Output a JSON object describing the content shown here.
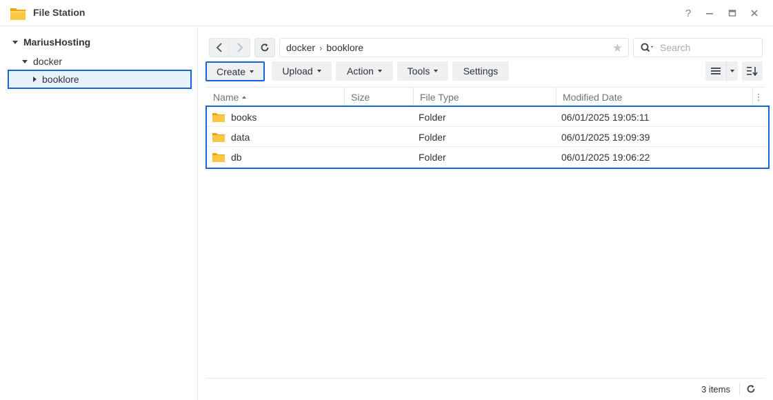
{
  "window": {
    "title": "File Station",
    "help_icon": "help-icon",
    "minimize_icon": "minimize-icon",
    "maximize_icon": "maximize-icon",
    "close_icon": "close-icon"
  },
  "tree": {
    "root": "MariusHosting",
    "children": [
      {
        "label": "docker",
        "expanded": true
      },
      {
        "label": "booklore",
        "selected": true
      }
    ]
  },
  "nav": {
    "path": [
      "docker",
      "booklore"
    ],
    "search_placeholder": "Search"
  },
  "toolbar": {
    "create": "Create",
    "upload": "Upload",
    "action": "Action",
    "tools": "Tools",
    "settings": "Settings"
  },
  "table": {
    "columns": [
      "Name",
      "Size",
      "File Type",
      "Modified Date"
    ],
    "rows": [
      {
        "name": "books",
        "size": "",
        "type": "Folder",
        "modified": "06/01/2025 19:05:11"
      },
      {
        "name": "data",
        "size": "",
        "type": "Folder",
        "modified": "06/01/2025 19:09:39"
      },
      {
        "name": "db",
        "size": "",
        "type": "Folder",
        "modified": "06/01/2025 19:06:22"
      }
    ]
  },
  "status": {
    "items": "3 items"
  },
  "colors": {
    "accent": "#1565d8",
    "folder": "#f9c33d",
    "selected_bg": "#e8f2fc"
  }
}
